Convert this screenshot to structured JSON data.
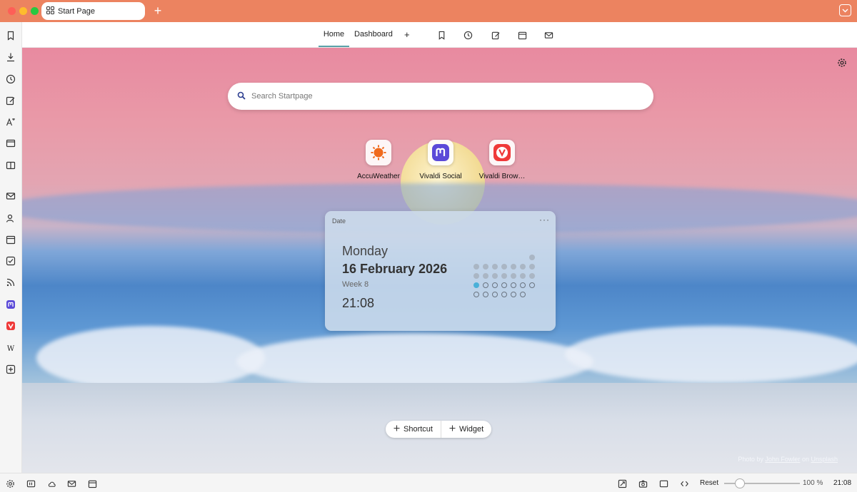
{
  "window": {
    "tab_title": "Start Page",
    "new_tab_symbol": "+"
  },
  "start_page": {
    "tabs": [
      "Home",
      "Dashboard"
    ],
    "add_symbol": "+",
    "header_icons": [
      "bookmark-icon",
      "history-icon",
      "notes-icon",
      "calendar-icon",
      "mail-icon"
    ]
  },
  "panel": {
    "icons": [
      "bookmarks-icon",
      "downloads-icon",
      "history-icon",
      "notes-icon",
      "translate-icon",
      "window-icon",
      "reading-list-icon",
      "mail-icon",
      "contacts-icon",
      "calendar-icon",
      "tasks-icon",
      "feeds-icon",
      "mastodon-icon",
      "vivaldi-icon",
      "wikipedia-icon",
      "add-panel-icon"
    ]
  },
  "search": {
    "placeholder": "Search Startpage"
  },
  "speed_dials": [
    {
      "label": "AccuWeather",
      "color": "#f06a1d"
    },
    {
      "label": "Vivaldi Social",
      "color": "#5b4ad8"
    },
    {
      "label": "Vivaldi Brow…",
      "color": "#ef3939"
    }
  ],
  "date_widget": {
    "title": "Date",
    "menu": "···",
    "day": "Monday",
    "date": "16 February 2026",
    "week": "Week 8",
    "time": "21:08"
  },
  "add_bar": {
    "shortcut": "Shortcut",
    "widget": "Widget"
  },
  "photo_credit": {
    "prefix": "Photo by",
    "author": "John Fowler",
    "on": "on",
    "site": "Unsplash"
  },
  "status_bar": {
    "reset": "Reset",
    "zoom": "100 %",
    "clock": "21:08"
  },
  "colors": {
    "titlebar": "#ec8360",
    "accent": "#5aa0a8"
  }
}
